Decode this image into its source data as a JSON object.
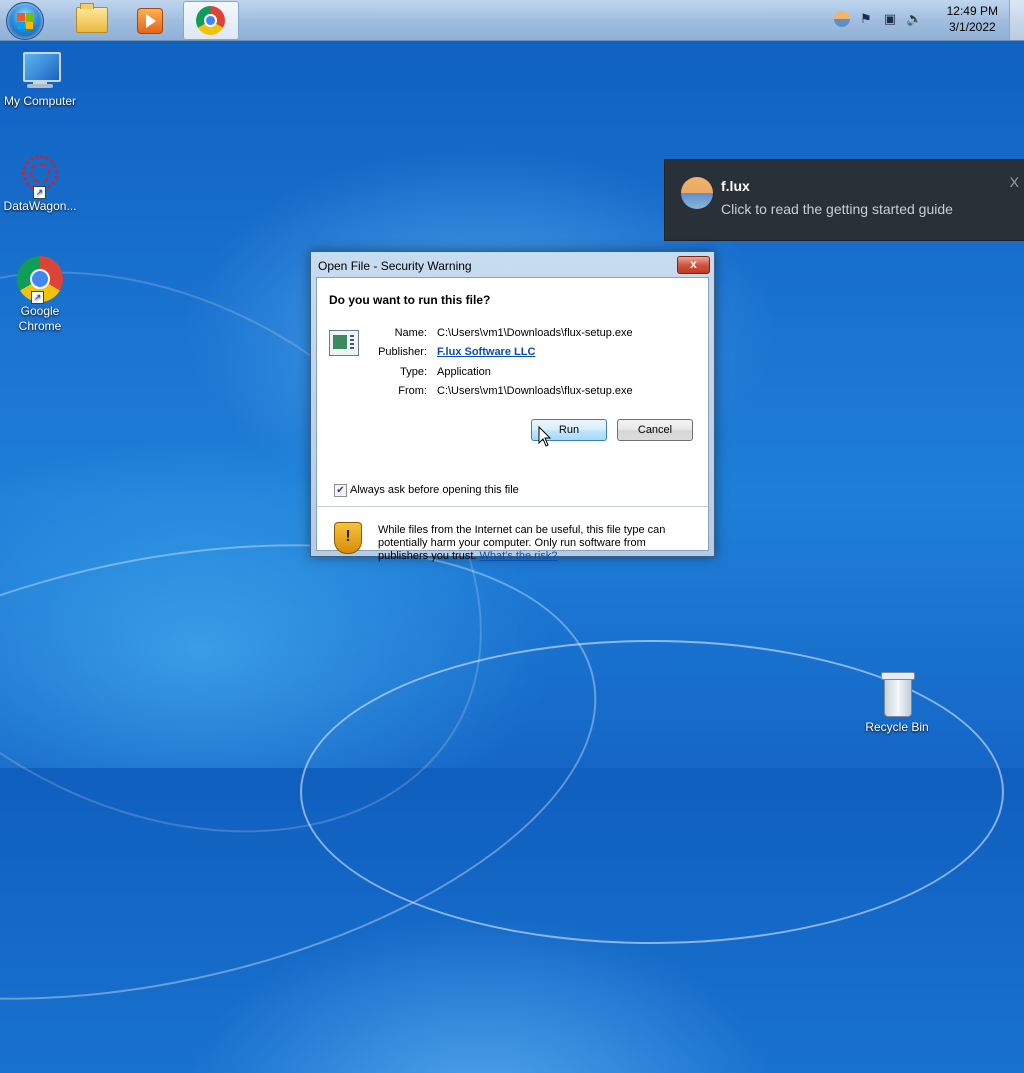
{
  "taskbar": {
    "start_label": "Start",
    "pinned": [
      "File Explorer",
      "Windows Media Player",
      "Google Chrome"
    ],
    "clock": {
      "time": "12:49 PM",
      "date": "3/1/2022"
    },
    "tray_icons": [
      "flux-tray-icon",
      "action-center-flag-icon",
      "network-icon",
      "volume-icon"
    ]
  },
  "desktop": {
    "icons": [
      {
        "label": "My Computer"
      },
      {
        "label": "DataWagon..."
      },
      {
        "label": "Google Chrome"
      },
      {
        "label": "Recycle Bin"
      }
    ]
  },
  "toast": {
    "title": "f.lux",
    "body": "Click to read the getting started guide",
    "close": "X"
  },
  "dialog": {
    "title": "Open File - Security Warning",
    "close": "x",
    "question": "Do you want to run this file?",
    "fields": {
      "name_label": "Name:",
      "name_value": "C:\\Users\\vm1\\Downloads\\flux-setup.exe",
      "publisher_label": "Publisher:",
      "publisher_value": "F.lux Software LLC",
      "type_label": "Type:",
      "type_value": "Application",
      "from_label": "From:",
      "from_value": "C:\\Users\\vm1\\Downloads\\flux-setup.exe"
    },
    "run_button": "Run",
    "cancel_button": "Cancel",
    "checkbox_label": "Always ask before opening this file",
    "checkbox_checked": true,
    "warning_text": "While files from the Internet can be useful, this file type can potentially harm your computer. Only run software from publishers you trust.",
    "warning_link": "What's the risk?"
  }
}
